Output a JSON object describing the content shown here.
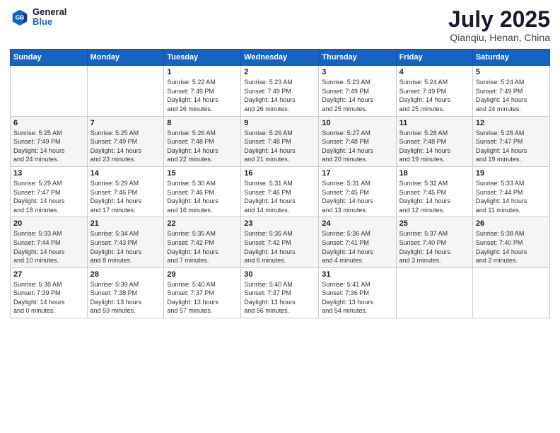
{
  "logo": {
    "general": "General",
    "blue": "Blue"
  },
  "title": {
    "month": "July 2025",
    "location": "Qianqiu, Henan, China"
  },
  "headers": [
    "Sunday",
    "Monday",
    "Tuesday",
    "Wednesday",
    "Thursday",
    "Friday",
    "Saturday"
  ],
  "weeks": [
    [
      {
        "day": "",
        "detail": ""
      },
      {
        "day": "",
        "detail": ""
      },
      {
        "day": "1",
        "detail": "Sunrise: 5:22 AM\nSunset: 7:49 PM\nDaylight: 14 hours\nand 26 minutes."
      },
      {
        "day": "2",
        "detail": "Sunrise: 5:23 AM\nSunset: 7:49 PM\nDaylight: 14 hours\nand 26 minutes."
      },
      {
        "day": "3",
        "detail": "Sunrise: 5:23 AM\nSunset: 7:49 PM\nDaylight: 14 hours\nand 25 minutes."
      },
      {
        "day": "4",
        "detail": "Sunrise: 5:24 AM\nSunset: 7:49 PM\nDaylight: 14 hours\nand 25 minutes."
      },
      {
        "day": "5",
        "detail": "Sunrise: 5:24 AM\nSunset: 7:49 PM\nDaylight: 14 hours\nand 24 minutes."
      }
    ],
    [
      {
        "day": "6",
        "detail": "Sunrise: 5:25 AM\nSunset: 7:49 PM\nDaylight: 14 hours\nand 24 minutes."
      },
      {
        "day": "7",
        "detail": "Sunrise: 5:25 AM\nSunset: 7:49 PM\nDaylight: 14 hours\nand 23 minutes."
      },
      {
        "day": "8",
        "detail": "Sunrise: 5:26 AM\nSunset: 7:48 PM\nDaylight: 14 hours\nand 22 minutes."
      },
      {
        "day": "9",
        "detail": "Sunrise: 5:26 AM\nSunset: 7:48 PM\nDaylight: 14 hours\nand 21 minutes."
      },
      {
        "day": "10",
        "detail": "Sunrise: 5:27 AM\nSunset: 7:48 PM\nDaylight: 14 hours\nand 20 minutes."
      },
      {
        "day": "11",
        "detail": "Sunrise: 5:28 AM\nSunset: 7:48 PM\nDaylight: 14 hours\nand 19 minutes."
      },
      {
        "day": "12",
        "detail": "Sunrise: 5:28 AM\nSunset: 7:47 PM\nDaylight: 14 hours\nand 19 minutes."
      }
    ],
    [
      {
        "day": "13",
        "detail": "Sunrise: 5:29 AM\nSunset: 7:47 PM\nDaylight: 14 hours\nand 18 minutes."
      },
      {
        "day": "14",
        "detail": "Sunrise: 5:29 AM\nSunset: 7:46 PM\nDaylight: 14 hours\nand 17 minutes."
      },
      {
        "day": "15",
        "detail": "Sunrise: 5:30 AM\nSunset: 7:46 PM\nDaylight: 14 hours\nand 16 minutes."
      },
      {
        "day": "16",
        "detail": "Sunrise: 5:31 AM\nSunset: 7:46 PM\nDaylight: 14 hours\nand 14 minutes."
      },
      {
        "day": "17",
        "detail": "Sunrise: 5:31 AM\nSunset: 7:45 PM\nDaylight: 14 hours\nand 13 minutes."
      },
      {
        "day": "18",
        "detail": "Sunrise: 5:32 AM\nSunset: 7:45 PM\nDaylight: 14 hours\nand 12 minutes."
      },
      {
        "day": "19",
        "detail": "Sunrise: 5:33 AM\nSunset: 7:44 PM\nDaylight: 14 hours\nand 11 minutes."
      }
    ],
    [
      {
        "day": "20",
        "detail": "Sunrise: 5:33 AM\nSunset: 7:44 PM\nDaylight: 14 hours\nand 10 minutes."
      },
      {
        "day": "21",
        "detail": "Sunrise: 5:34 AM\nSunset: 7:43 PM\nDaylight: 14 hours\nand 8 minutes."
      },
      {
        "day": "22",
        "detail": "Sunrise: 5:35 AM\nSunset: 7:42 PM\nDaylight: 14 hours\nand 7 minutes."
      },
      {
        "day": "23",
        "detail": "Sunrise: 5:35 AM\nSunset: 7:42 PM\nDaylight: 14 hours\nand 6 minutes."
      },
      {
        "day": "24",
        "detail": "Sunrise: 5:36 AM\nSunset: 7:41 PM\nDaylight: 14 hours\nand 4 minutes."
      },
      {
        "day": "25",
        "detail": "Sunrise: 5:37 AM\nSunset: 7:40 PM\nDaylight: 14 hours\nand 3 minutes."
      },
      {
        "day": "26",
        "detail": "Sunrise: 5:38 AM\nSunset: 7:40 PM\nDaylight: 14 hours\nand 2 minutes."
      }
    ],
    [
      {
        "day": "27",
        "detail": "Sunrise: 5:38 AM\nSunset: 7:39 PM\nDaylight: 14 hours\nand 0 minutes."
      },
      {
        "day": "28",
        "detail": "Sunrise: 5:39 AM\nSunset: 7:38 PM\nDaylight: 13 hours\nand 59 minutes."
      },
      {
        "day": "29",
        "detail": "Sunrise: 5:40 AM\nSunset: 7:37 PM\nDaylight: 13 hours\nand 57 minutes."
      },
      {
        "day": "30",
        "detail": "Sunrise: 5:40 AM\nSunset: 7:37 PM\nDaylight: 13 hours\nand 56 minutes."
      },
      {
        "day": "31",
        "detail": "Sunrise: 5:41 AM\nSunset: 7:36 PM\nDaylight: 13 hours\nand 54 minutes."
      },
      {
        "day": "",
        "detail": ""
      },
      {
        "day": "",
        "detail": ""
      }
    ]
  ]
}
